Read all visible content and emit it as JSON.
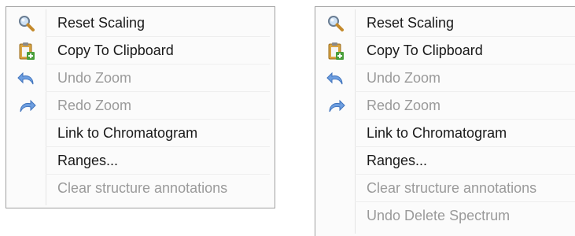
{
  "menus": [
    {
      "items": [
        {
          "label": "Reset Scaling",
          "icon": "magnifier-icon",
          "enabled": true
        },
        {
          "label": "Copy To Clipboard",
          "icon": "clipboard-icon",
          "enabled": true
        },
        {
          "label": "Undo Zoom",
          "icon": "undo-icon",
          "enabled": false
        },
        {
          "label": "Redo Zoom",
          "icon": "redo-icon",
          "enabled": false
        },
        {
          "label": "Link to Chromatogram",
          "icon": "",
          "enabled": true
        },
        {
          "label": "Ranges...",
          "icon": "",
          "enabled": true
        },
        {
          "label": "Clear structure annotations",
          "icon": "",
          "enabled": false
        }
      ]
    },
    {
      "items": [
        {
          "label": "Reset Scaling",
          "icon": "magnifier-icon",
          "enabled": true
        },
        {
          "label": "Copy To Clipboard",
          "icon": "clipboard-icon",
          "enabled": true
        },
        {
          "label": "Undo Zoom",
          "icon": "undo-icon",
          "enabled": false
        },
        {
          "label": "Redo Zoom",
          "icon": "redo-icon",
          "enabled": false
        },
        {
          "label": "Link to Chromatogram",
          "icon": "",
          "enabled": true
        },
        {
          "label": "Ranges...",
          "icon": "",
          "enabled": true
        },
        {
          "label": "Clear structure annotations",
          "icon": "",
          "enabled": false
        },
        {
          "label": "Undo Delete Spectrum",
          "icon": "",
          "enabled": false
        }
      ]
    }
  ],
  "colors": {
    "menu_bg": "#fbfbfb",
    "border": "#a0a0a0",
    "text_enabled": "#1a1a1a",
    "text_disabled": "#9a9a9a",
    "undo_redo_icon": "#5b8fd6"
  }
}
